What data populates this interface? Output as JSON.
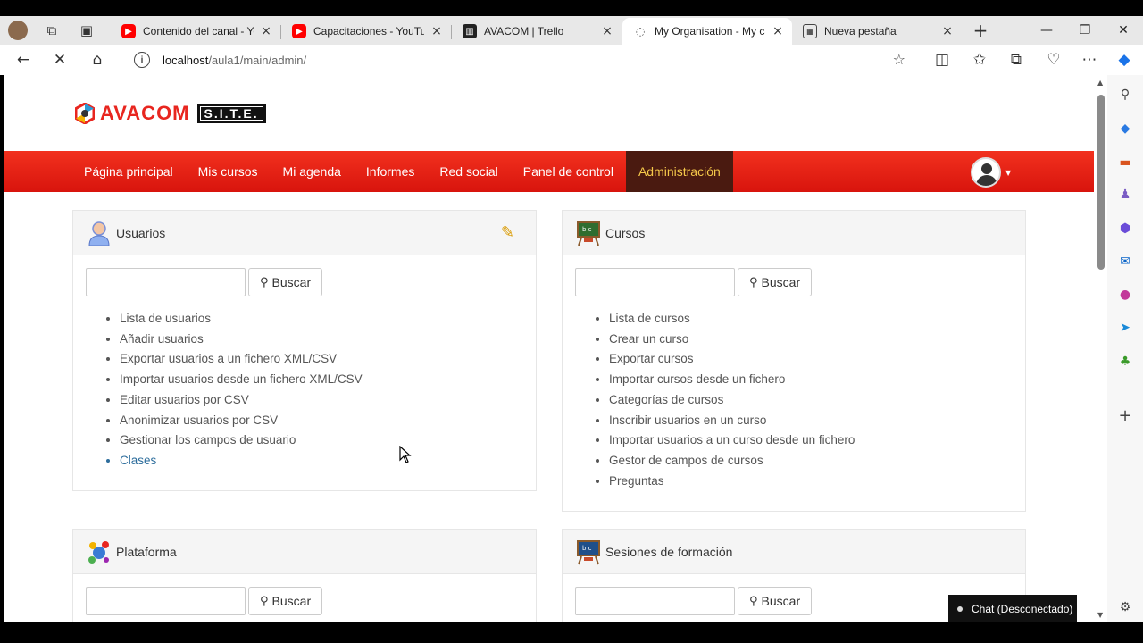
{
  "browser": {
    "tabs": [
      {
        "label": "Contenido del canal - YouTube",
        "icon": "youtube-icon"
      },
      {
        "label": "Capacitaciones - YouTube",
        "icon": "youtube-icon"
      },
      {
        "label": "AVACOM | Trello",
        "icon": "trello-icon"
      },
      {
        "label": "My Organisation - My canal",
        "icon": "loading-icon",
        "active": true
      },
      {
        "label": "Nueva pestaña",
        "icon": "new-tab-page-icon"
      }
    ],
    "url_host": "localhost",
    "url_path": "/aula1/main/admin/"
  },
  "site": {
    "brand": "AVACOM",
    "brand_tag": "S.I.T.E."
  },
  "nav": {
    "items": [
      "Página principal",
      "Mis cursos",
      "Mi agenda",
      "Informes",
      "Red social",
      "Panel de control",
      "Administración"
    ],
    "active_index": 6
  },
  "panels": {
    "usuarios": {
      "title": "Usuarios",
      "search_button": "Buscar",
      "links": [
        "Lista de usuarios",
        "Añadir usuarios",
        "Exportar usuarios a un fichero XML/CSV",
        "Importar usuarios desde un fichero XML/CSV",
        "Editar usuarios por CSV",
        "Anonimizar usuarios por CSV",
        "Gestionar los campos de usuario",
        "Clases"
      ]
    },
    "cursos": {
      "title": "Cursos",
      "search_button": "Buscar",
      "links": [
        "Lista de cursos",
        "Crear un curso",
        "Exportar cursos",
        "Importar cursos desde un fichero",
        "Categorías de cursos",
        "Inscribir usuarios en un curso",
        "Importar usuarios a un curso desde un fichero",
        "Gestor de campos de cursos",
        "Preguntas"
      ]
    },
    "plataforma": {
      "title": "Plataforma",
      "search_button": "Buscar"
    },
    "sesiones": {
      "title": "Sesiones de formación",
      "search_button": "Buscar"
    }
  },
  "chat": {
    "label": "Chat (Desconectado)"
  },
  "colors": {
    "nav_red": "#e8261f",
    "nav_active_bg": "#4a1a10",
    "nav_active_text": "#f5c84a",
    "link_blue": "#2d6d9c"
  }
}
